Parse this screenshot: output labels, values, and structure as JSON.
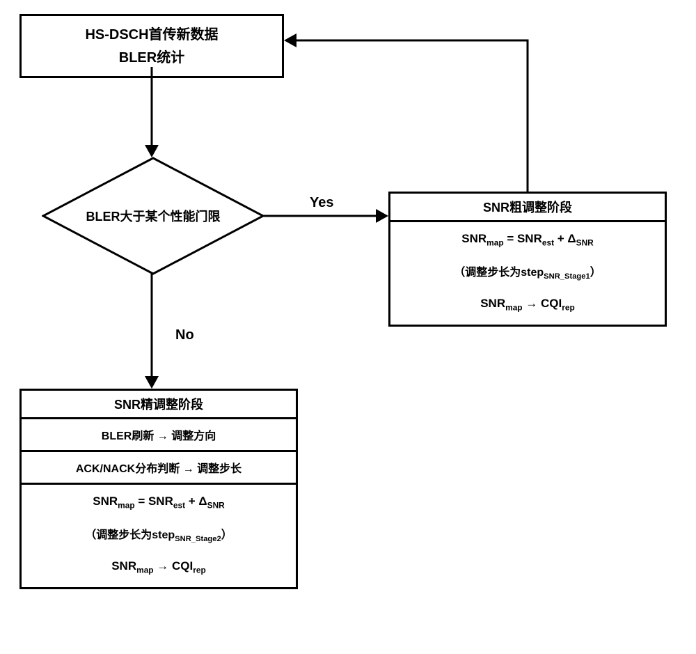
{
  "chart_data": {
    "type": "flowchart",
    "nodes": [
      {
        "id": "start",
        "type": "process",
        "lines": [
          "HS-DSCH首传新数据",
          "BLER统计"
        ]
      },
      {
        "id": "decision",
        "type": "decision",
        "text": "BLER大于某个性能门限"
      },
      {
        "id": "coarse",
        "type": "process_multi",
        "title": "SNR粗调整阶段",
        "rows": [
          "SNRmap = SNRest + ΔSNR",
          "（调整步长为stepSNR_Stage1）",
          "SNRmap → CQIrep"
        ]
      },
      {
        "id": "fine",
        "type": "process_multi",
        "title": "SNR精调整阶段",
        "rows": [
          "BLER刷新 → 调整方向",
          "ACK/NACK分布判断 → 调整步长",
          "SNRmap = SNRest + ΔSNR",
          "（调整步长为stepSNR_Stage2）",
          "SNRmap → CQIrep"
        ]
      }
    ],
    "edges": [
      {
        "from": "start",
        "to": "decision",
        "label": ""
      },
      {
        "from": "decision",
        "to": "coarse",
        "label": "Yes"
      },
      {
        "from": "decision",
        "to": "fine",
        "label": "No"
      },
      {
        "from": "coarse",
        "to": "start",
        "label": ""
      }
    ]
  },
  "start_box": {
    "line1": "HS-DSCH首传新数据",
    "line2": "BLER统计"
  },
  "decision": {
    "text": "BLER大于某个性能门限"
  },
  "yes_label": "Yes",
  "no_label": "No",
  "coarse": {
    "title": "SNR粗调整阶段",
    "formula_html": "SNR<sub>map</sub> = SNR<sub>est</sub> + Δ<sub>SNR</sub>",
    "step_note_html": "（调整步长为step<sub>SNR_Stage1</sub>）",
    "map_html": "SNR<sub>map</sub> → CQI<sub>rep</sub>"
  },
  "fine": {
    "title": "SNR精调整阶段",
    "row1": "BLER刷新 → 调整方向",
    "row2": "ACK/NACK分布判断 → 调整步长",
    "formula_html": "SNR<sub>map</sub> = SNR<sub>est</sub> + Δ<sub>SNR</sub>",
    "step_note_html": "（调整步长为step<sub>SNR_Stage2</sub>）",
    "map_html": "SNR<sub>map</sub> → CQI<sub>rep</sub>"
  }
}
